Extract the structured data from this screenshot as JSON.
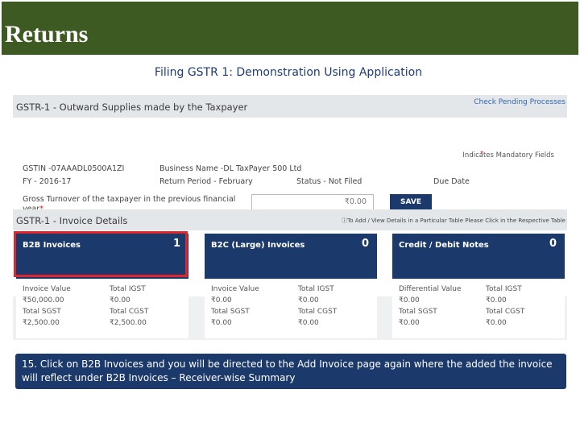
{
  "header": {
    "title": "Returns",
    "subtitle": "Filing GSTR 1: Demonstration Using Application"
  },
  "gstr": {
    "outward_header": "GSTR-1 - Outward Supplies made by the Taxpayer",
    "check_pending_link": "Check Pending Processes",
    "mandatory_note": "Indicates Mandatory Fields",
    "gstin": "GSTIN -07AAADL0500A1ZI",
    "business_name": "Business Name -DL TaxPayer 500 Ltd",
    "fy": "FY - 2016-17",
    "return_period": "Return Period - February",
    "status": "Status - Not Filed",
    "due_date": "Due Date",
    "turnover_label": "Gross Turnover of the taxpayer in the previous financial year",
    "turnover_value": "₹0.00",
    "save_label": "SAVE",
    "invoice_header": "GSTR-1 - Invoice Details",
    "invoice_note": "To Add / View Details in a Particular Table Please Click in the Respective Table"
  },
  "tiles": [
    {
      "label": "B2B Invoices",
      "count": "1",
      "summary": [
        [
          "Invoice Value",
          "Total IGST"
        ],
        [
          "₹50,000.00",
          "₹0.00"
        ],
        [
          "Total SGST",
          "Total CGST"
        ],
        [
          "₹2,500.00",
          "₹2,500.00"
        ]
      ]
    },
    {
      "label": "B2C (Large) Invoices",
      "count": "0",
      "summary": [
        [
          "Invoice Value",
          "Total IGST"
        ],
        [
          "₹0.00",
          "₹0.00"
        ],
        [
          "Total SGST",
          "Total CGST"
        ],
        [
          "₹0.00",
          "₹0.00"
        ]
      ]
    },
    {
      "label": "Credit / Debit Notes",
      "count": "0",
      "summary": [
        [
          "Differential Value",
          "Total IGST"
        ],
        [
          "₹0.00",
          "₹0.00"
        ],
        [
          "Total SGST",
          "Total CGST"
        ],
        [
          "₹0.00",
          "₹0.00"
        ]
      ]
    }
  ],
  "caption": "15. Click on B2B Invoices and you will be directed to the Add Invoice page again where the added the invoice will reflect under B2B Invoices – Receiver-wise Summary",
  "colors": {
    "title_band": "#3e5a23",
    "tile_navy": "#1b3a6b",
    "highlight_red": "#e0262c",
    "link_blue": "#2f66b3"
  }
}
